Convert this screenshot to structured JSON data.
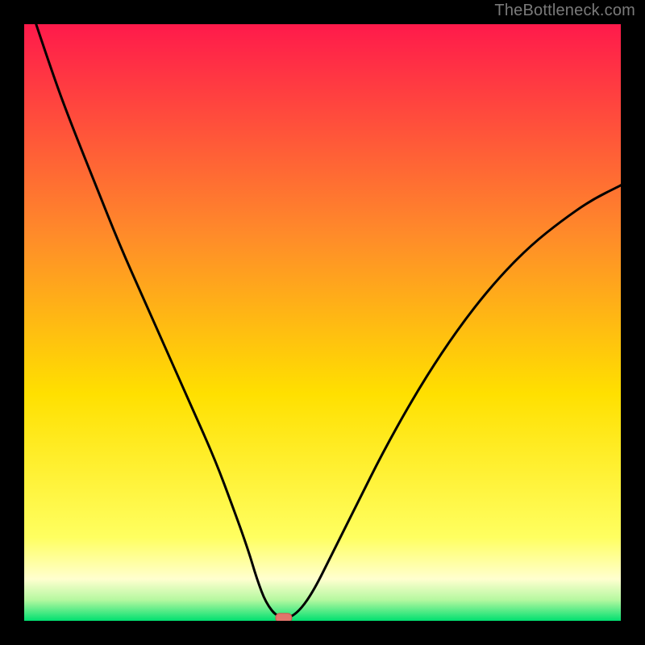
{
  "watermark": "TheBottleneck.com",
  "colors": {
    "black": "#000000",
    "curve": "#000000",
    "marker_fill": "#e2756b",
    "marker_stroke": "#c85a50",
    "gradient_top": "#ff1a4b",
    "gradient_mid1": "#ff8a2a",
    "gradient_mid2": "#ffe000",
    "gradient_band": "#ffff9a",
    "gradient_green": "#00e070"
  },
  "chart_data": {
    "type": "line",
    "title": "",
    "xlabel": "",
    "ylabel": "",
    "xlim": [
      0,
      100
    ],
    "ylim": [
      0,
      100
    ],
    "note": "Axes are unlabeled; values are normalized 0–100 estimates read from pixel positions.",
    "series": [
      {
        "name": "bottleneck-curve",
        "x": [
          2,
          5,
          8,
          12,
          16,
          20,
          24,
          28,
          32,
          35,
          37.5,
          39,
          40.5,
          42.5,
          45,
          48,
          52,
          56,
          60,
          65,
          70,
          75,
          80,
          85,
          90,
          95,
          100
        ],
        "y": [
          100,
          91,
          83,
          73,
          63,
          54,
          45,
          36,
          27,
          19,
          12,
          7,
          3,
          0.5,
          0.5,
          4,
          12,
          20,
          28,
          37,
          45,
          52,
          58,
          63,
          67,
          70.5,
          73
        ]
      }
    ],
    "marker": {
      "x": 43.5,
      "y": 0.5,
      "shape": "rounded-rect"
    },
    "background_gradient": {
      "direction": "vertical",
      "stops": [
        {
          "pos": 0.0,
          "color": "#ff1a4b"
        },
        {
          "pos": 0.35,
          "color": "#ff8a2a"
        },
        {
          "pos": 0.62,
          "color": "#ffe000"
        },
        {
          "pos": 0.86,
          "color": "#ffff60"
        },
        {
          "pos": 0.93,
          "color": "#ffffcf"
        },
        {
          "pos": 0.965,
          "color": "#b5f8a0"
        },
        {
          "pos": 1.0,
          "color": "#00e070"
        }
      ]
    }
  }
}
